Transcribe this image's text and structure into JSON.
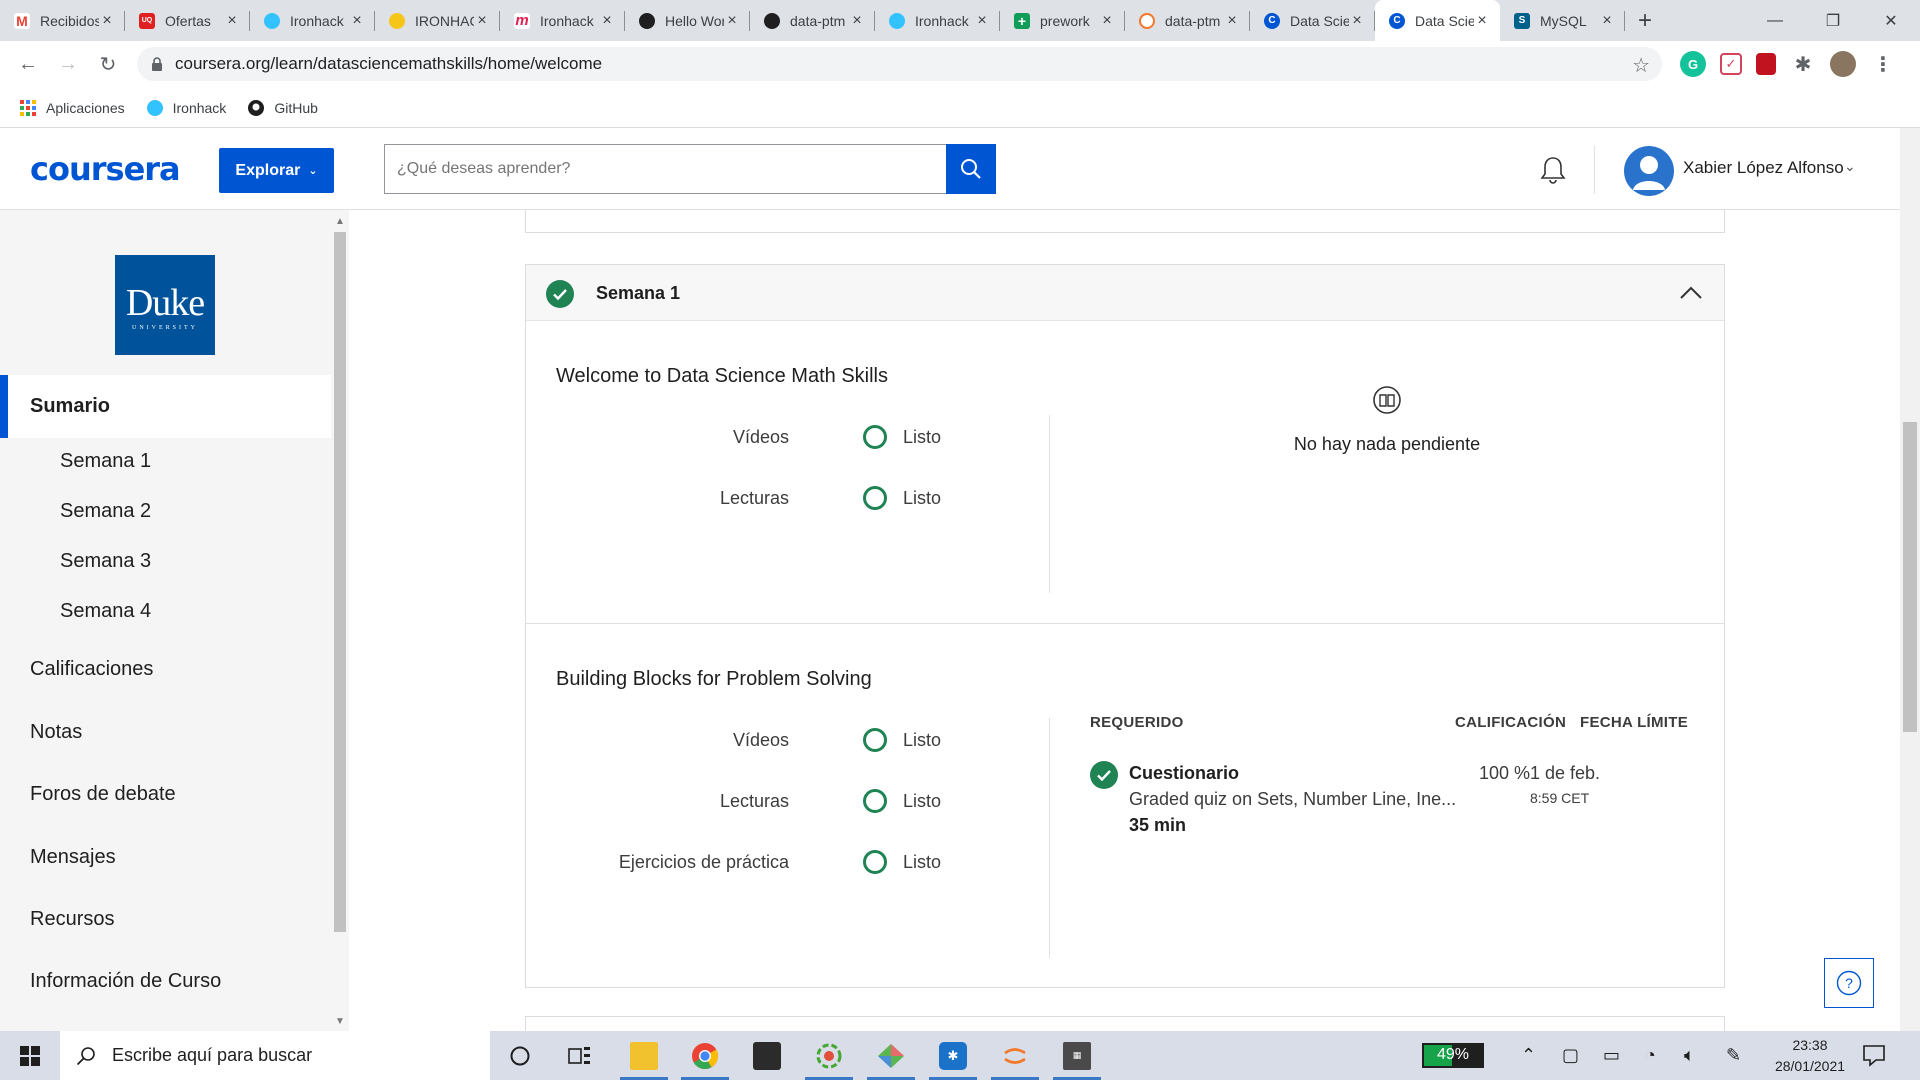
{
  "browser": {
    "tabs": [
      {
        "title": "Recibidos",
        "icon": "gmail-icon",
        "color": "#ea4335",
        "active": false
      },
      {
        "title": "Ofertas",
        "icon": "uniqlo-icon",
        "color": "#e02020",
        "active": false
      },
      {
        "title": "Ironhack",
        "icon": "ironhack-icon",
        "color": "#32c3ff",
        "active": false
      },
      {
        "title": "IRONHACK",
        "icon": "wave-hand-icon",
        "color": "#f5c518",
        "active": false
      },
      {
        "title": "Ironhack",
        "icon": "moodle-icon",
        "color": "#e02050",
        "active": false
      },
      {
        "title": "Hello World",
        "icon": "github-icon",
        "color": "#1f1f1f",
        "active": false
      },
      {
        "title": "data-ptm",
        "icon": "github-icon",
        "color": "#1f1f1f",
        "active": false
      },
      {
        "title": "Ironhack",
        "icon": "ironhack-icon",
        "color": "#32c3ff",
        "active": false
      },
      {
        "title": "prework",
        "icon": "sheets-icon",
        "color": "#0f9d58",
        "active": false
      },
      {
        "title": "data-ptm",
        "icon": "jupyter-icon",
        "color": "#f37726",
        "active": false
      },
      {
        "title": "Data Science",
        "icon": "coursera-icon",
        "color": "#0056d2",
        "active": false
      },
      {
        "title": "Data Science",
        "icon": "coursera-icon",
        "color": "#0056d2",
        "active": true
      },
      {
        "title": "MySQL",
        "icon": "mysql-icon",
        "color": "#00618a",
        "active": false
      }
    ],
    "url": "coursera.org/learn/datasciencemathskills/home/welcome",
    "bookmarks": [
      {
        "label": "Aplicaciones",
        "icon": "apps-grid-icon"
      },
      {
        "label": "Ironhack",
        "icon": "ironhack-icon"
      },
      {
        "label": "GitHub",
        "icon": "github-icon"
      }
    ]
  },
  "header": {
    "logo": "coursera",
    "explore_label": "Explorar",
    "search_placeholder": "¿Qué deseas aprender?",
    "user_name": "Xabier López Alfonso"
  },
  "sidebar": {
    "university_logo": {
      "name": "Duke",
      "sub": "UNIVERSITY"
    },
    "active_item": "Sumario",
    "weeks": [
      "Semana 1",
      "Semana 2",
      "Semana 3",
      "Semana 4"
    ],
    "items": [
      "Calificaciones",
      "Notas",
      "Foros de debate",
      "Mensajes",
      "Recursos",
      "Información de Curso"
    ]
  },
  "week": {
    "title": "Semana 1",
    "completed": true,
    "lessons": [
      {
        "title": "Welcome to Data Science Math Skills",
        "progress": [
          {
            "label": "Vídeos",
            "status": "Listo"
          },
          {
            "label": "Lecturas",
            "status": "Listo"
          }
        ],
        "pending_message": "No hay nada pendiente"
      },
      {
        "title": "Building Blocks for Problem Solving",
        "progress": [
          {
            "label": "Vídeos",
            "status": "Listo"
          },
          {
            "label": "Lecturas",
            "status": "Listo"
          },
          {
            "label": "Ejercicios de práctica",
            "status": "Listo"
          }
        ],
        "table_headers": {
          "required": "REQUERIDO",
          "grade": "CALIFICACIÓN",
          "deadline": "FECHA LÍMITE"
        },
        "assignment": {
          "name": "Cuestionario",
          "description": "Graded quiz on Sets, Number Line, Ine...",
          "duration": "35 min",
          "grade": "100 %",
          "due_date": "1 de feb.",
          "due_time": "8:59 CET",
          "completed": true
        }
      }
    ]
  },
  "taskbar": {
    "search_placeholder": "Escribe aquí para buscar",
    "battery": "49%",
    "battery_level": 0.49,
    "time": "23:38",
    "date": "28/01/2021"
  },
  "colors": {
    "coursera_blue": "#0056d2",
    "success_green": "#1f8354",
    "duke_blue": "#00539b"
  }
}
